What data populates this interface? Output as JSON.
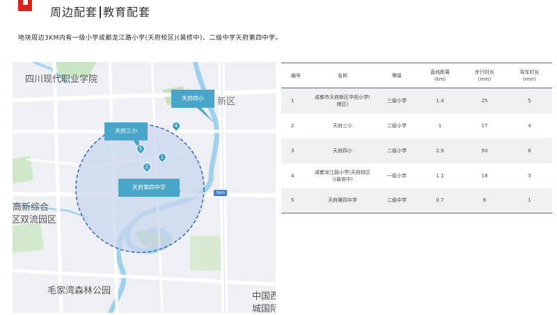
{
  "header": {
    "title_left": "周边配套",
    "title_right": "教育配套"
  },
  "intro": "地块周边3KM内有一级小学成都龙江路小学(天府校区)(装修中)、二级中学天府第四中学。",
  "map": {
    "labels": {
      "college": "四川现代职业学院",
      "new_area": "新区",
      "gaoxin_1": "高新综合",
      "gaoxin_2": "区双流园区",
      "park": "毛家湾森林公园",
      "china_1": "中国西",
      "china_2": "城国际"
    },
    "km_tag": "3km",
    "callouts": {
      "school_4": "天府四小",
      "school_3": "天府三小",
      "middle_4": "天府第四中学"
    },
    "markers": [
      "1",
      "2",
      "4",
      "5"
    ],
    "colors": {
      "circle_fill": "#c9d6ef",
      "circle_stroke": "#3a6fb0",
      "callout": "#4aa6c8",
      "water": "#8fc7ea",
      "green": "#b7dfb2",
      "road": "#ffffff"
    }
  },
  "table": {
    "headers": {
      "no": "编号",
      "name": "名称",
      "grade": "等级",
      "dist_1": "直线距离",
      "dist_2": "(km)",
      "walk_1": "步行时长",
      "walk_2": "(min)",
      "drive_1": "驾车时长",
      "drive_2": "(min)"
    },
    "rows": [
      {
        "no": "1",
        "name_1": "成都市天府新区华阳小学(",
        "name_2": "南区)",
        "grade": "三级小学",
        "dist": "1.4",
        "walk": "25",
        "drive": "5"
      },
      {
        "no": "2",
        "name_1": "天府三小",
        "name_2": "",
        "grade": "二级小学",
        "dist": "1",
        "walk": "17",
        "drive": "4"
      },
      {
        "no": "3",
        "name_1": "天府四小",
        "name_2": "",
        "grade": "二级小学",
        "dist": "2.9",
        "walk": "50",
        "drive": "8"
      },
      {
        "no": "4",
        "name_1": "成都龙江路小学(天府校区",
        "name_2": ")(装修中)",
        "grade": "一级小学",
        "dist": "1.1",
        "walk": "18",
        "drive": "3"
      },
      {
        "no": "5",
        "name_1": "天府第四中学",
        "name_2": "",
        "grade": "二级中学",
        "dist": "0.7",
        "walk": "6",
        "drive": "1"
      }
    ]
  }
}
